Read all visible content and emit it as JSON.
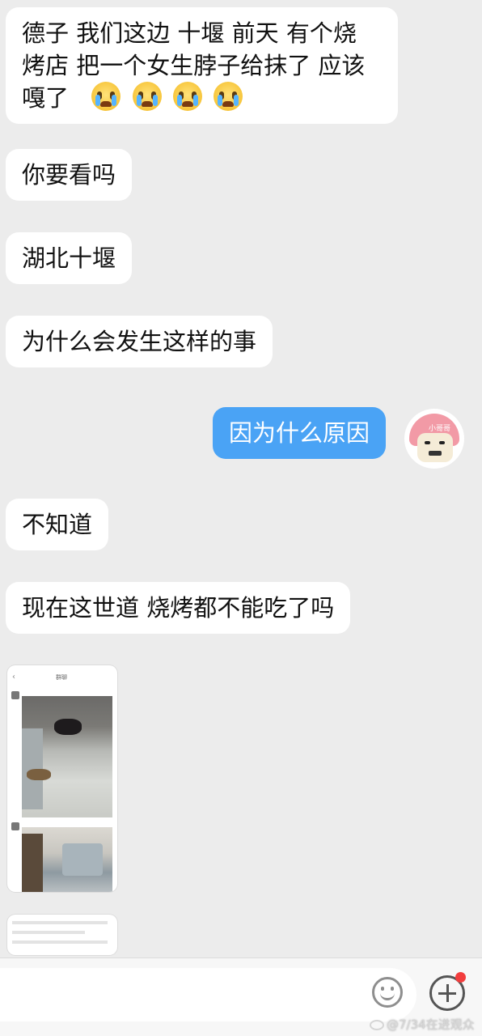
{
  "messages": [
    {
      "side": "left",
      "lines": [
        "德子 我们这边 十堰 前天 有个烧",
        "烤店 把一个女生脖子给抹了 应该",
        "嘎了"
      ]
    },
    {
      "side": "left",
      "text": "你要看吗"
    },
    {
      "side": "left",
      "text": "湖北十堰"
    },
    {
      "side": "left",
      "text": "为什么会发生这样的事"
    },
    {
      "side": "right",
      "text": "因为什么原因"
    },
    {
      "side": "left",
      "text": "不知道"
    },
    {
      "side": "left",
      "text": "现在这世道 烧烤都不能吃了吗"
    }
  ],
  "emoji_icons": [
    "crying-face",
    "crying-face",
    "crying-face",
    "crying-face"
  ],
  "avatar": {
    "helmet_text": "小哥哥"
  },
  "image_cards": [
    {
      "title": "群聊"
    },
    {
      "title": ""
    }
  ],
  "input_bar": {
    "icons": [
      "smile-icon",
      "plus-icon"
    ],
    "notification_dot": "#f23d3d"
  },
  "watermark": "@7/34在进观众",
  "colors": {
    "background": "#ececec",
    "bubble_left": "#ffffff",
    "bubble_right": "#4aa3f5"
  }
}
